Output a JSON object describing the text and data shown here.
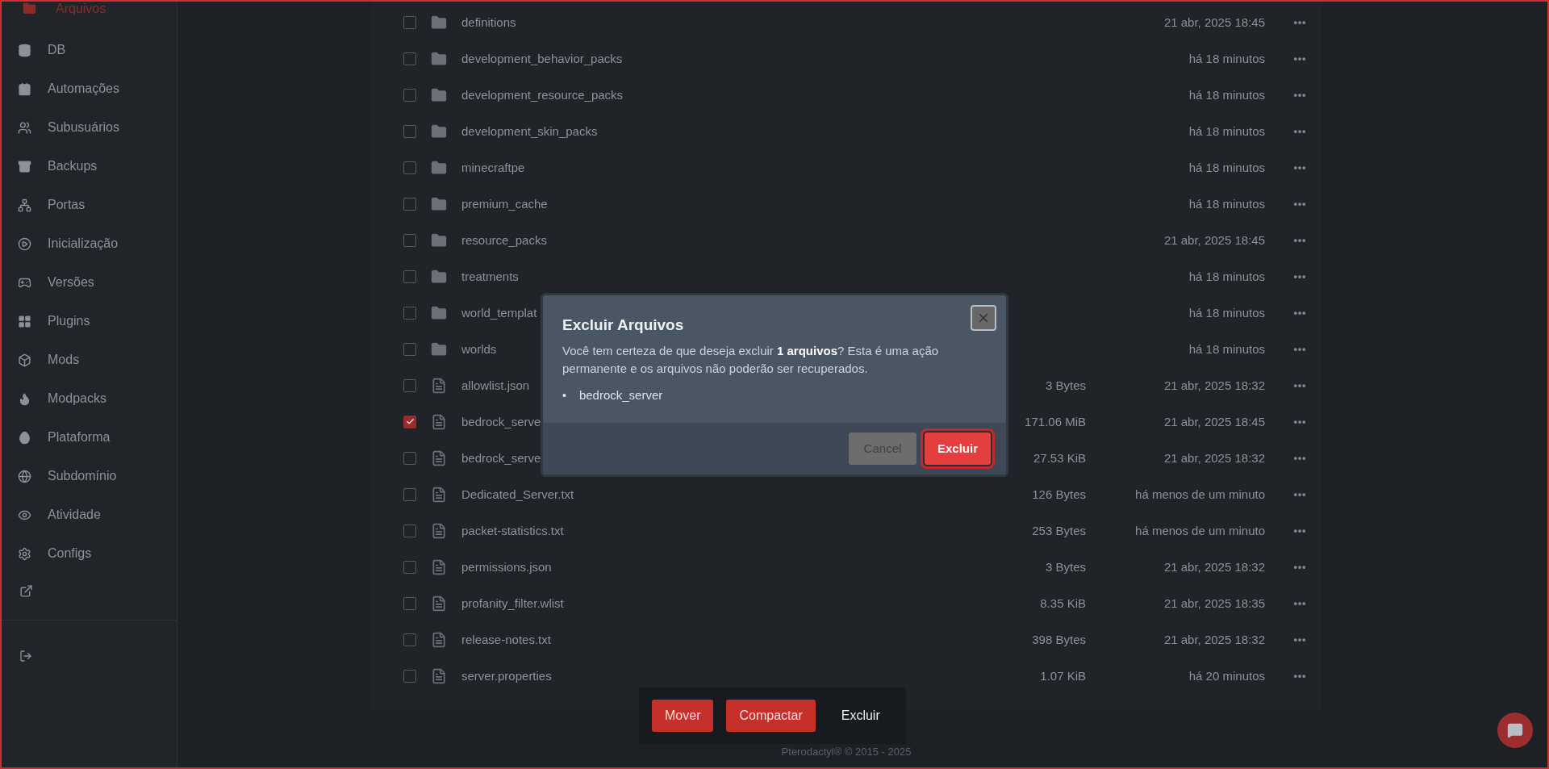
{
  "sidebar": {
    "items": [
      {
        "label": "Arquivos",
        "selected": true
      },
      {
        "label": "DB",
        "selected": false
      },
      {
        "label": "Automações",
        "selected": false
      },
      {
        "label": "Subusuários",
        "selected": false
      },
      {
        "label": "Backups",
        "selected": false
      },
      {
        "label": "Portas",
        "selected": false
      },
      {
        "label": "Inicialização",
        "selected": false
      },
      {
        "label": "Versões",
        "selected": false
      },
      {
        "label": "Plugins",
        "selected": false
      },
      {
        "label": "Mods",
        "selected": false
      },
      {
        "label": "Modpacks",
        "selected": false
      },
      {
        "label": "Plataforma",
        "selected": false
      },
      {
        "label": "Subdomínio",
        "selected": false
      },
      {
        "label": "Atividade",
        "selected": false
      },
      {
        "label": "Configs",
        "selected": false
      }
    ]
  },
  "files": [
    {
      "kind": "folder",
      "name": "definitions",
      "modified": "21 abr, 2025 18:45",
      "checked": false
    },
    {
      "kind": "folder",
      "name": "development_behavior_packs",
      "modified": "há 18 minutos",
      "checked": false
    },
    {
      "kind": "folder",
      "name": "development_resource_packs",
      "modified": "há 18 minutos",
      "checked": false
    },
    {
      "kind": "folder",
      "name": "development_skin_packs",
      "modified": "há 18 minutos",
      "checked": false
    },
    {
      "kind": "folder",
      "name": "minecraftpe",
      "modified": "há 18 minutos",
      "checked": false
    },
    {
      "kind": "folder",
      "name": "premium_cache",
      "modified": "há 18 minutos",
      "checked": false
    },
    {
      "kind": "folder",
      "name": "resource_packs",
      "modified": "21 abr, 2025 18:45",
      "checked": false
    },
    {
      "kind": "folder",
      "name": "treatments",
      "modified": "há 18 minutos",
      "checked": false
    },
    {
      "kind": "folder",
      "name": "world_templat",
      "modified": "há 18 minutos",
      "checked": false
    },
    {
      "kind": "folder",
      "name": "worlds",
      "modified": "há 18 minutos",
      "checked": false
    },
    {
      "kind": "file",
      "name": "allowlist.json",
      "size": "3 Bytes",
      "modified": "21 abr, 2025 18:32",
      "checked": false
    },
    {
      "kind": "file",
      "name": "bedrock_serve",
      "size": "171.06 MiB",
      "modified": "21 abr, 2025 18:45",
      "checked": true
    },
    {
      "kind": "file",
      "name": "bedrock_serve",
      "size": "27.53 KiB",
      "modified": "21 abr, 2025 18:32",
      "checked": false
    },
    {
      "kind": "file",
      "name": "Dedicated_Server.txt",
      "size": "126 Bytes",
      "modified": "há menos de um minuto",
      "checked": false
    },
    {
      "kind": "file",
      "name": "packet-statistics.txt",
      "size": "253 Bytes",
      "modified": "há menos de um minuto",
      "checked": false
    },
    {
      "kind": "file",
      "name": "permissions.json",
      "size": "3 Bytes",
      "modified": "21 abr, 2025 18:32",
      "checked": false
    },
    {
      "kind": "file",
      "name": "profanity_filter.wlist",
      "size": "8.35 KiB",
      "modified": "21 abr, 2025 18:35",
      "checked": false
    },
    {
      "kind": "file",
      "name": "release-notes.txt",
      "size": "398 Bytes",
      "modified": "21 abr, 2025 18:32",
      "checked": false
    },
    {
      "kind": "file",
      "name": "server.properties",
      "size": "1.07 KiB",
      "modified": "há 20 minutos",
      "checked": false
    }
  ],
  "bulk_actions": [
    "Mover",
    "Compactar",
    "Excluir"
  ],
  "footer": "Pterodactyl® © 2015 - 2025",
  "dialog": {
    "title": "Excluir Arquivos",
    "message": "Você tem certeza de que deseja excluir **1 arquivos**? Esta é uma ação permanente e os arquivos não poderão ser recuperados.",
    "bullet": "•",
    "items": [
      "bedrock_server"
    ],
    "cancel": "Cancel",
    "confirm": "Excluir"
  }
}
